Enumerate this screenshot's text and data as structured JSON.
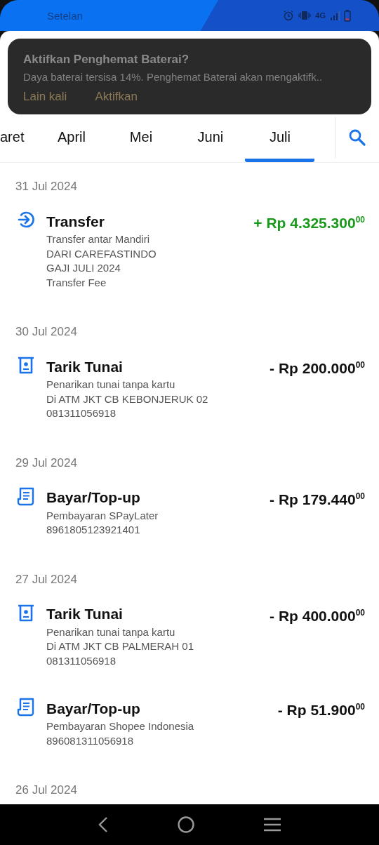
{
  "status_bar": {
    "title": "Setelan",
    "network": "4G"
  },
  "notification": {
    "title": "Aktifkan Penghemat Baterai?",
    "body": "Daya baterai tersisa 14%. Penghemat Baterai akan mengaktifk..",
    "actions": [
      "Lain kali",
      "Aktifkan"
    ]
  },
  "tabs": [
    {
      "label": "aret",
      "selected": false
    },
    {
      "label": "April",
      "selected": false
    },
    {
      "label": "Mei",
      "selected": false
    },
    {
      "label": "Juni",
      "selected": false
    },
    {
      "label": "Juli",
      "selected": true
    }
  ],
  "sections": [
    {
      "date": "31 Jul 2024",
      "transactions": [
        {
          "kind": "transfer",
          "credit": true,
          "title": "Transfer",
          "amount": "+ Rp 4.325.300$^{00}$",
          "details": [
            "Transfer antar Mandiri",
            "DARI CAREFASTINDO",
            "GAJI JULI 2024",
            "Transfer Fee"
          ]
        }
      ]
    },
    {
      "date": "30 Jul 2024",
      "transactions": [
        {
          "kind": "atm",
          "credit": false,
          "title": "Tarik Tunai",
          "amount": "- Rp 200.000$^{00}$",
          "details": [
            "Penarikan tunai tanpa kartu",
            "Di ATM JKT CB KEBONJERUK 02",
            "081311056918"
          ]
        }
      ]
    },
    {
      "date": "29 Jul 2024",
      "transactions": [
        {
          "kind": "bill",
          "credit": false,
          "title": "Bayar/Top-up",
          "amount": "- Rp 179.440$^{00}$",
          "details": [
            "Pembayaran SPayLater",
            "8961805123921401"
          ]
        }
      ]
    },
    {
      "date": "27 Jul 2024",
      "transactions": [
        {
          "kind": "atm",
          "credit": false,
          "title": "Tarik Tunai",
          "amount": "- Rp 400.000$^{00}$",
          "details": [
            "Penarikan tunai tanpa kartu",
            "Di ATM JKT CB PALMERAH 01",
            "081311056918"
          ]
        },
        {
          "kind": "bill",
          "credit": false,
          "title": "Bayar/Top-up",
          "amount": "- Rp 51.900$^{00}$",
          "details": [
            "Pembayaran Shopee Indonesia",
            "896081311056918"
          ]
        }
      ]
    },
    {
      "date": "26 Jul 2024"
    }
  ]
}
